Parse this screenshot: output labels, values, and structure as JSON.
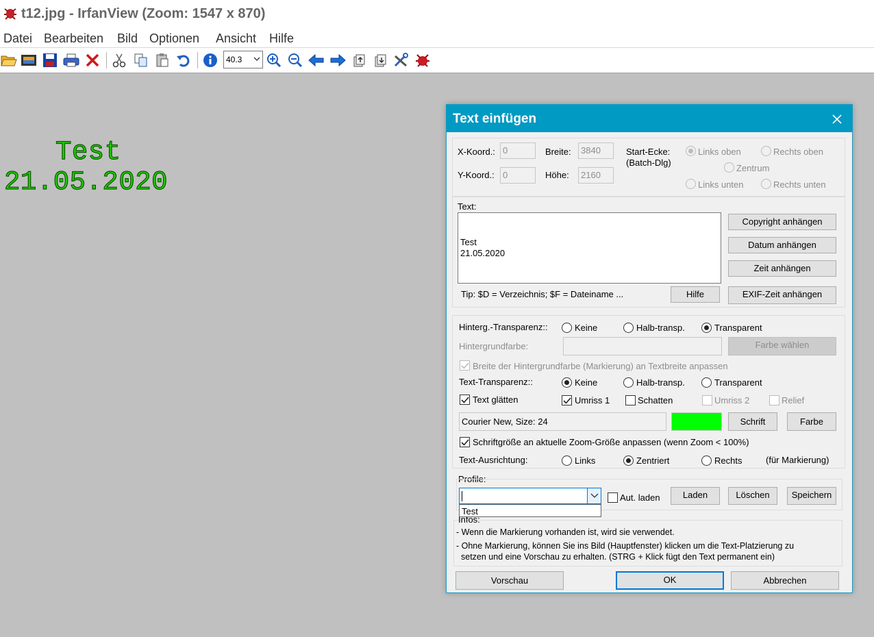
{
  "window": {
    "title": "t12.jpg - IrfanView (Zoom: 1547 x 870)"
  },
  "menu": [
    "Datei",
    "Bearbeiten",
    "Bild",
    "Optionen",
    "Ansicht",
    "Hilfe"
  ],
  "toolbar": {
    "zoom_value": "40.3",
    "icons": [
      "open-folder-icon",
      "slideshow-icon",
      "save-icon",
      "print-icon",
      "delete-icon",
      "cut-icon",
      "copy-icon",
      "paste-icon",
      "undo-icon",
      "info-icon",
      "zoom-in-icon",
      "zoom-out-icon",
      "previous-icon",
      "next-icon",
      "first-page-icon",
      "last-page-icon",
      "settings-icon",
      "irfanview-logo-icon"
    ]
  },
  "canvas": {
    "line1": "Test",
    "line2": "21.05.2020",
    "text_color": "#22cc00"
  },
  "dialog": {
    "title": "Text einfügen",
    "position": {
      "x_label": "X-Koord.:",
      "x_value": "0",
      "y_label": "Y-Koord.:",
      "y_value": "0",
      "width_label": "Breite:",
      "width_value": "3840",
      "height_label": "Höhe:",
      "height_value": "2160",
      "start_corner_label": "Start-Ecke:",
      "start_corner_sub": "(Batch-Dlg)",
      "corners": [
        "Links oben",
        "Rechts oben",
        "Zentrum",
        "Links unten",
        "Rechts unten"
      ],
      "corner_selected": "Links oben"
    },
    "text": {
      "label": "Text:",
      "line1": "Test",
      "line2": "21.05.2020",
      "tip": "Tip: $D = Verzeichnis; $F = Dateiname ...",
      "help_button": "Hilfe",
      "copyright_button": "Copyright anhängen",
      "date_button": "Datum anhängen",
      "time_button": "Zeit anhängen",
      "exif_button": "EXIF-Zeit anhängen"
    },
    "appearance": {
      "bg_transparency_label": "Hinterg.-Transparenz::",
      "bg_options": [
        "Keine",
        "Halb-transp.",
        "Transparent"
      ],
      "bg_selected": "Transparent",
      "bg_color_label": "Hintergrundfarbe:",
      "choose_color_button": "Farbe wählen",
      "bg_width_check": "Breite der Hintergrundfarbe (Markierung) an Textbreite anpassen",
      "text_transparency_label": "Text-Transparenz::",
      "text_options": [
        "Keine",
        "Halb-transp.",
        "Transparent"
      ],
      "text_selected": "Keine",
      "smooth_check": "Text glätten",
      "outline1_check": "Umriss 1",
      "shadow_check": "Schatten",
      "outline2_check": "Umriss 2",
      "relief_check": "Relief",
      "font_info": "Courier New, Size: 24",
      "text_color": "#00ff00",
      "font_button": "Schrift",
      "color_button": "Farbe",
      "zoom_size_check": "Schriftgröße an aktuelle Zoom-Größe anpassen (wenn Zoom < 100%)",
      "alignment_label": "Text-Ausrichtung:",
      "align_options": [
        "Links",
        "Zentriert",
        "Rechts"
      ],
      "align_selected": "Zentriert",
      "align_note": "(für Markierung)"
    },
    "profile": {
      "label": "Profile:",
      "current_value": "",
      "dropdown_items": [
        "Test"
      ],
      "autoload_check": "Aut. laden",
      "load_button": "Laden",
      "delete_button": "Löschen",
      "save_button": "Speichern"
    },
    "infos": {
      "label": "Infos:",
      "line1": "- Wenn die Markierung vorhanden ist, wird sie verwendet.",
      "line2": "- Ohne Markierung, können Sie ins Bild (Hauptfenster) klicken um die Text-Platzierung zu",
      "line3": "setzen und eine Vorschau zu erhalten. (STRG + Klick fügt den Text permanent ein)"
    },
    "buttons": {
      "preview": "Vorschau",
      "ok": "OK",
      "cancel": "Abbrechen"
    }
  }
}
